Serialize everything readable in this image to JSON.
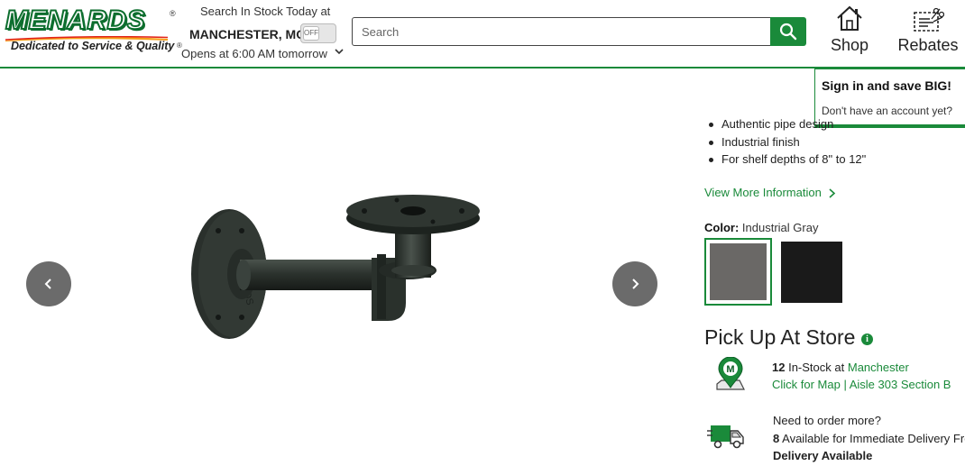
{
  "brand": {
    "logo_text": "MENARDS",
    "logo_mark": "®",
    "tagline": "Dedicated to Service & Quality",
    "tagline_mark": "®",
    "green": "#1a8a3a"
  },
  "store": {
    "title": "Search In Stock Today at",
    "city": "MANCHESTER, MO",
    "toggle_state": "OFF",
    "hours": "Opens at 6:00 AM tomorrow"
  },
  "search": {
    "placeholder": "Search",
    "value": ""
  },
  "nav": {
    "shop_label": "Shop",
    "rebates_label": "Rebates"
  },
  "signin_popup": {
    "title": "Sign in and save BIG!",
    "subtitle": "Don't have an account yet?"
  },
  "product": {
    "features": [
      "Authentic pipe design",
      "Industrial finish",
      "For shelf depths of 8\" to 12\""
    ],
    "more_info_label": "View More Information",
    "color_label": "Color:",
    "color_value": "Industrial Gray",
    "swatches": [
      {
        "name": "Industrial Gray",
        "color": "#6a6866",
        "selected": true
      },
      {
        "name": "Black",
        "color": "#1a1a1a",
        "selected": false
      }
    ]
  },
  "pickup": {
    "title": "Pick Up At Store",
    "info_glyph": "i",
    "stock_count": "12",
    "stock_text": "In-Stock at",
    "store_name": "Manchester",
    "map_link": "Click for Map | Aisle 303 Section B"
  },
  "delivery": {
    "order_more": "Need to order more?",
    "count": "8",
    "count_text": "Available for Immediate Delivery From",
    "available": "Delivery Available"
  }
}
